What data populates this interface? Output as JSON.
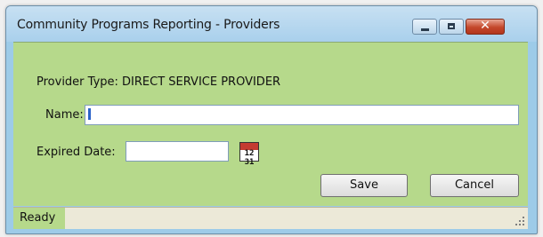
{
  "window": {
    "title": "Community Programs Reporting - Providers"
  },
  "titlebar_controls": {
    "close_glyph": "✕"
  },
  "form": {
    "provider_type_label": "Provider Type: DIRECT SERVICE PROVIDER",
    "name_label": "Name:",
    "name_value": "",
    "expired_date_label": "Expired Date:",
    "expired_date_value": "",
    "calendar_icon_text": "12\n31",
    "save_label": "Save",
    "cancel_label": "Cancel"
  },
  "statusbar": {
    "status": "Ready"
  },
  "colors": {
    "client_background": "#b6d98b",
    "titlebar": "#a9d0ec",
    "close_button": "#c4472b"
  },
  "icons": {
    "minimize": "minimize-icon",
    "maximize": "maximize-icon",
    "close": "close-icon",
    "calendar": "calendar-icon"
  }
}
